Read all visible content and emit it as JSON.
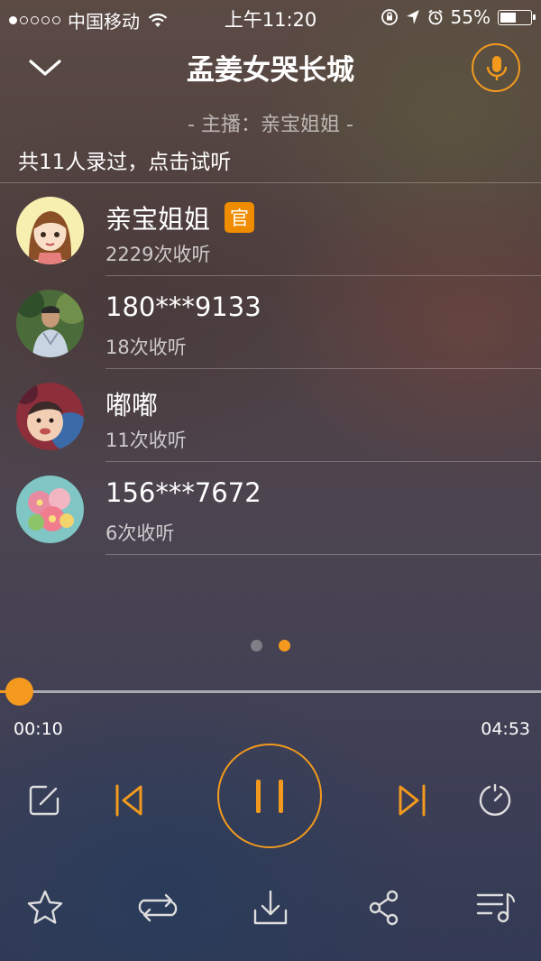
{
  "status_bar": {
    "carrier": "中国移动",
    "time": "上午11:20",
    "battery": "55%",
    "battery_level": 0.55
  },
  "header": {
    "title": "孟姜女哭长城",
    "host_line": "- 主播：亲宝姐姐 -"
  },
  "recordings": {
    "summary": "共11人录过，点击试听",
    "items": [
      {
        "name": "亲宝姐姐",
        "badge": "官",
        "plays": "2229次收听"
      },
      {
        "name": "180***9133",
        "plays": "18次收听"
      },
      {
        "name": "嘟嘟",
        "plays": "11次收听"
      },
      {
        "name": "156***7672",
        "plays": "6次收听"
      }
    ]
  },
  "pager": {
    "pages": 2,
    "active": 2
  },
  "player": {
    "elapsed": "00:10",
    "total": "04:53",
    "progress_fraction": 0.035,
    "state": "playing"
  },
  "colors": {
    "accent": "#f39a1e",
    "badge": "#f08c00"
  },
  "icons": {
    "header": [
      "chevron-down-icon",
      "microphone-icon"
    ],
    "controls": [
      "edit-icon",
      "previous-track-icon",
      "pause-icon",
      "next-track-icon",
      "timer-icon"
    ],
    "bottom_bar": [
      "favorite-star-icon",
      "repeat-icon",
      "download-icon",
      "share-icon",
      "playlist-icon"
    ]
  }
}
